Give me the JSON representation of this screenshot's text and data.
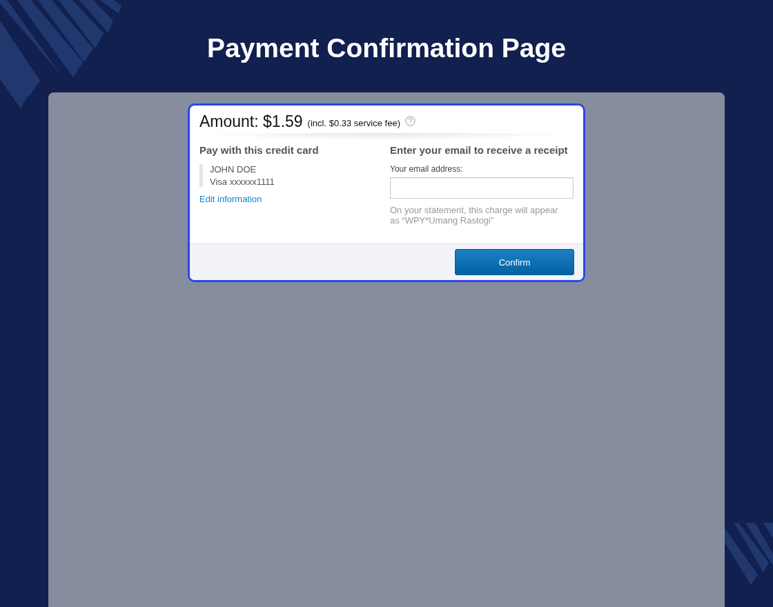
{
  "page_title": "Payment Confirmation Page",
  "amount": {
    "label": "Amount: $1.59",
    "fee": "(incl. $0.33 service fee)",
    "help": "?"
  },
  "card_section": {
    "heading": "Pay with this credit card",
    "holder": "JOHN DOE",
    "card": "Visa xxxxxx1111",
    "edit_link": "Edit information"
  },
  "email_section": {
    "heading": "Enter your email to receive a receipt",
    "field_label": "Your email address:",
    "note": "On your statement, this charge will appear as “WPY*Umang Rastogi”"
  },
  "buttons": [
    "Confirm"
  ]
}
